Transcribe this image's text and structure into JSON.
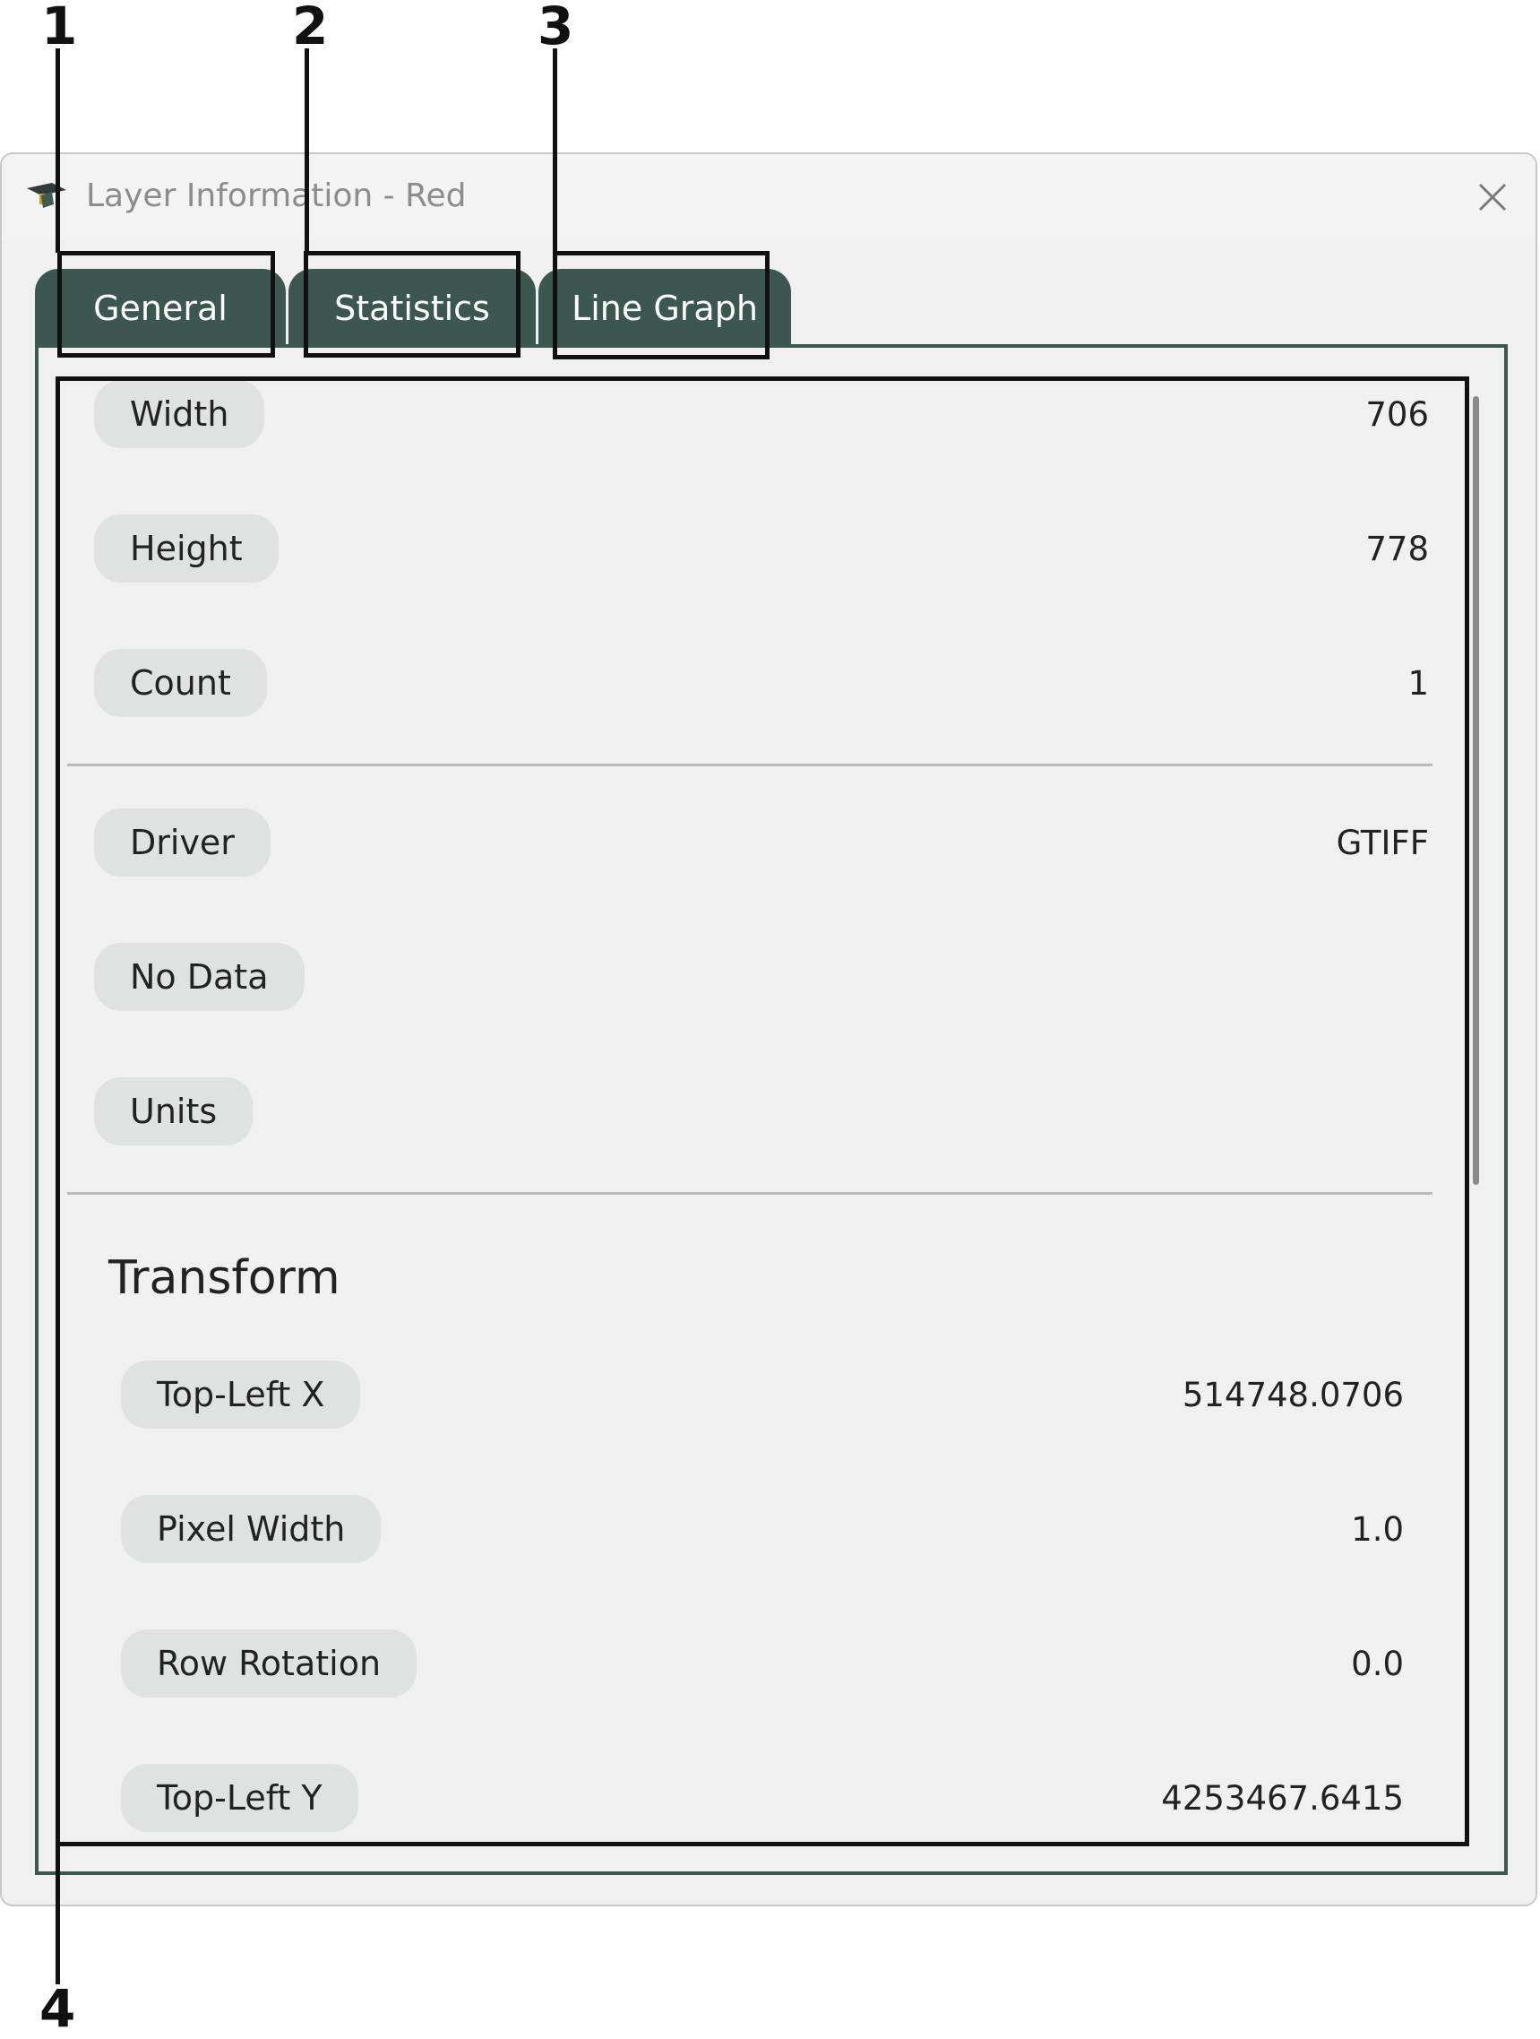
{
  "window": {
    "title": "Layer Information - Red",
    "close_icon": "close-icon",
    "app_icon": "app-icon",
    "accent": "#3b5750"
  },
  "tabs": [
    {
      "label": "General"
    },
    {
      "label": "Statistics"
    },
    {
      "label": "Line Graph"
    }
  ],
  "callouts": [
    "1",
    "2",
    "3",
    "4"
  ],
  "general": {
    "group1": [
      {
        "label": "Width",
        "value": "706"
      },
      {
        "label": "Height",
        "value": "778"
      },
      {
        "label": "Count",
        "value": "1"
      }
    ],
    "group2": [
      {
        "label": "Driver",
        "value": "GTIFF"
      },
      {
        "label": "No Data",
        "value": ""
      },
      {
        "label": "Units",
        "value": ""
      }
    ],
    "transform": {
      "title": "Transform",
      "rows": [
        {
          "label": "Top-Left X",
          "value": "514748.0706"
        },
        {
          "label": "Pixel Width",
          "value": "1.0"
        },
        {
          "label": "Row Rotation",
          "value": "0.0"
        },
        {
          "label": "Top-Left Y",
          "value": "4253467.6415"
        }
      ]
    }
  }
}
